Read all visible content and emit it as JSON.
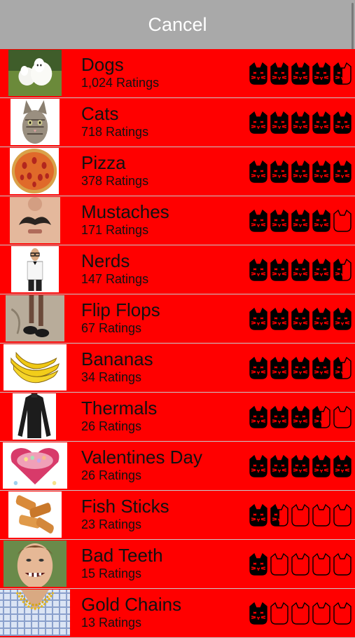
{
  "nav": {
    "cancel_label": "Cancel"
  },
  "colors": {
    "row_background": "#ff0000",
    "header_background": "#a9a9a9",
    "cat_icon": "#000000"
  },
  "rating_icon": "cat-face-icon",
  "max_rating": 5,
  "items": [
    {
      "name": "Dogs",
      "count": "1,024 Ratings",
      "rating": 4.5,
      "image": "dogs-photo"
    },
    {
      "name": "Cats",
      "count": "718 Ratings",
      "rating": 5,
      "image": "cat-photo"
    },
    {
      "name": "Pizza",
      "count": "378 Ratings",
      "rating": 5,
      "image": "pizza-photo"
    },
    {
      "name": "Mustaches",
      "count": "171 Ratings",
      "rating": 4,
      "image": "mustache-photo"
    },
    {
      "name": "Nerds",
      "count": "147 Ratings",
      "rating": 4.5,
      "image": "nerd-photo"
    },
    {
      "name": "Flip Flops",
      "count": "67 Ratings",
      "rating": 5,
      "image": "flip-flops-photo"
    },
    {
      "name": "Bananas",
      "count": "34 Ratings",
      "rating": 4.5,
      "image": "bananas-photo"
    },
    {
      "name": "Thermals",
      "count": "26 Ratings",
      "rating": 3.5,
      "image": "thermal-shirt-photo"
    },
    {
      "name": "Valentines Day",
      "count": "26 Ratings",
      "rating": 5,
      "image": "valentine-candy-photo"
    },
    {
      "name": "Fish Sticks",
      "count": "23 Ratings",
      "rating": 1.5,
      "image": "fish-sticks-photo"
    },
    {
      "name": "Bad Teeth",
      "count": "15 Ratings",
      "rating": 1,
      "image": "bad-teeth-photo"
    },
    {
      "name": "Gold Chains",
      "count": "13 Ratings",
      "rating": 1,
      "image": "gold-chains-photo"
    }
  ]
}
